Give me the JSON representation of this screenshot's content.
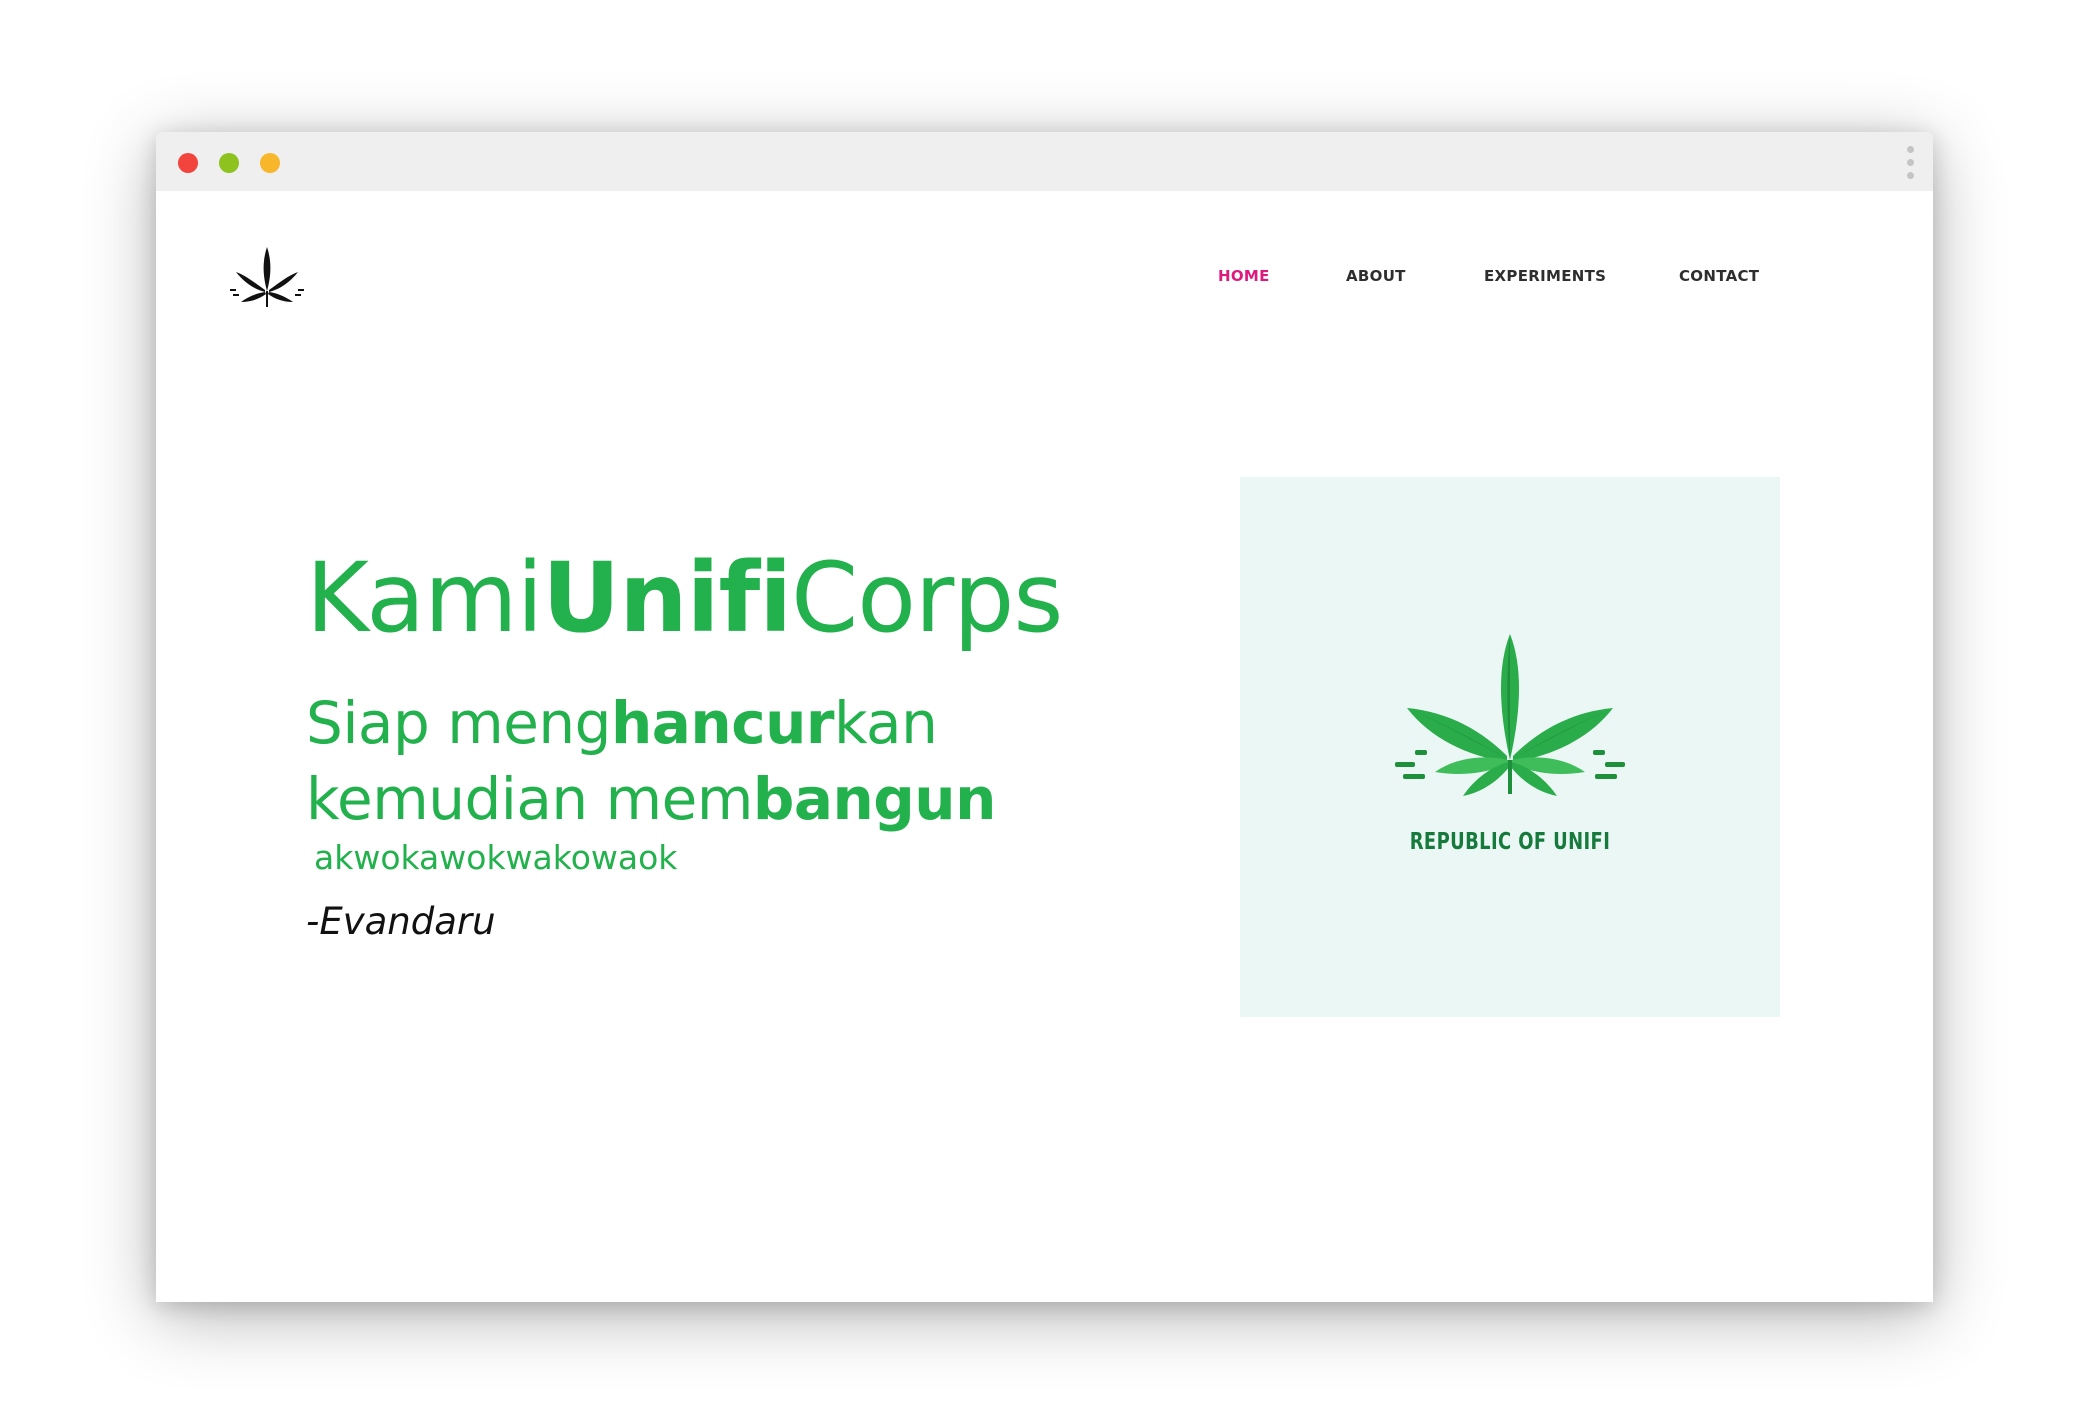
{
  "window": {
    "controls": {
      "close_color": "#f2433c",
      "minimize_color": "#8dc21f",
      "maximize_color": "#f8b62a"
    },
    "menu_icon": "vertical-dots-icon"
  },
  "header": {
    "logo_icon": "cannabis-leaf-icon",
    "nav": [
      {
        "label": "HOME",
        "active": true
      },
      {
        "label": "ABOUT",
        "active": false
      },
      {
        "label": "EXPERIMENTS",
        "active": false
      },
      {
        "label": "CONTACT",
        "active": false
      }
    ],
    "active_color": "#e0197d",
    "nav_color": "#2e2e2e"
  },
  "hero": {
    "title_part1": "Kami",
    "title_bold": "Unifi",
    "title_part2": "Corps",
    "line1_part1": "Siap meng",
    "line1_bold": "hancur",
    "line1_part2": "kan",
    "line2_part1": "kemudian mem",
    "line2_bold": "bangun",
    "tagline": "akwokawokwakowaok",
    "author": "-Evandaru",
    "text_color": "#22b14c"
  },
  "logo_card": {
    "icon": "cannabis-leaf-icon",
    "caption": "REPUBLIC OF UNIFI",
    "background": "#ebf7f5"
  }
}
